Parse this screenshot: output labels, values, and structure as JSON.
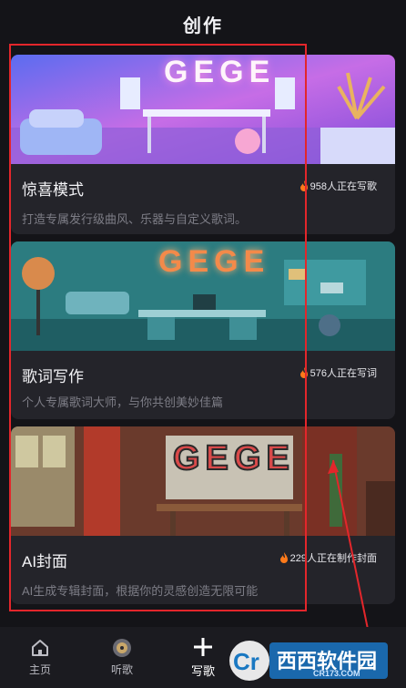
{
  "header": {
    "title": "创作"
  },
  "cards": [
    {
      "art_text": "GEGE",
      "title": "惊喜模式",
      "stat": "958人正在写歌",
      "desc": "打造专属发行级曲风、乐器与自定义歌词。"
    },
    {
      "art_text": "GEGE",
      "title": "歌词写作",
      "stat": "576人正在写词",
      "desc": "个人专属歌词大师，与你共创美妙佳篇"
    },
    {
      "art_text": "GEGE",
      "title": "AI封面",
      "stat": "229人正在制作封面",
      "desc": "AI生成专辑封面，根据你的灵感创造无限可能"
    }
  ],
  "nav": {
    "home": "主页",
    "listen": "听歌",
    "write": "写歌"
  },
  "watermark": {
    "brand": "西西软件园",
    "domain": "CR173.COM",
    "letter": "Cr"
  },
  "colors": {
    "accent": "#e3262b",
    "flame": "#ff7a1a",
    "background": "#141418",
    "card": "#24242a"
  }
}
